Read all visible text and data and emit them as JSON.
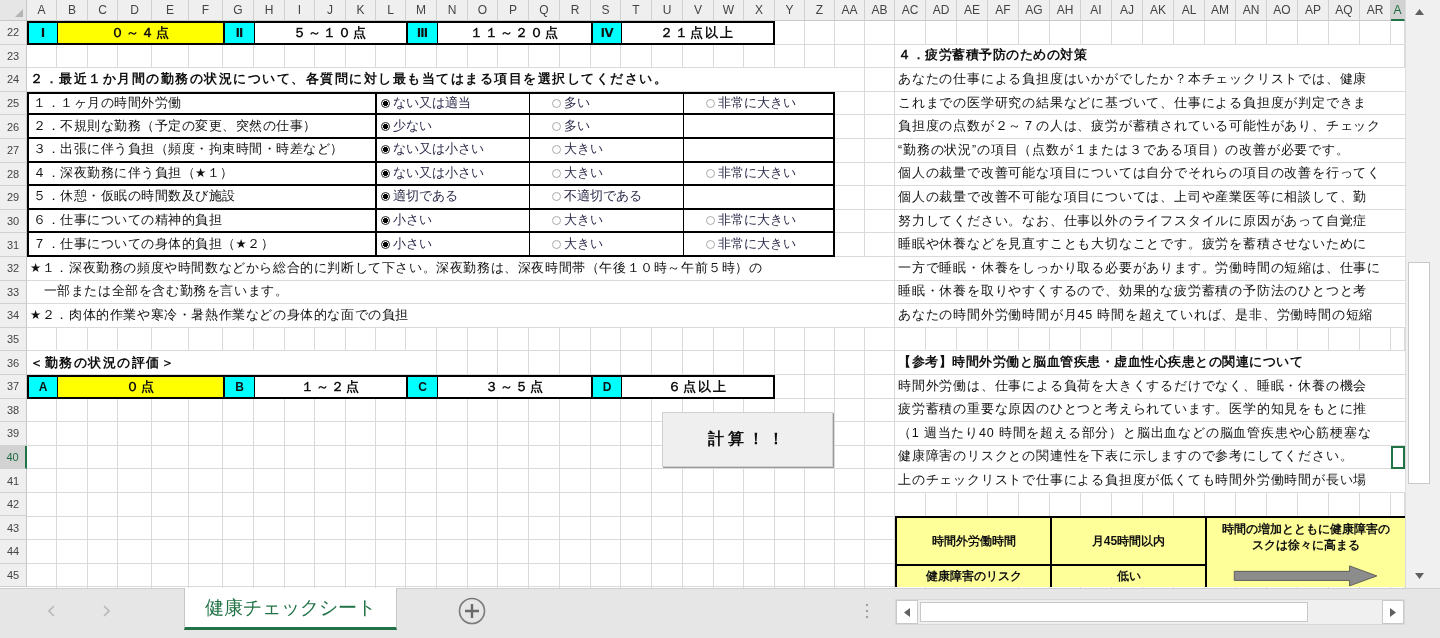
{
  "columns": [
    {
      "label": "A",
      "selected": false
    },
    {
      "label": "B",
      "selected": false
    },
    {
      "label": "C",
      "selected": false
    },
    {
      "label": "D",
      "selected": false
    },
    {
      "label": "E",
      "selected": false
    },
    {
      "label": "F",
      "selected": false
    },
    {
      "label": "G",
      "selected": false
    },
    {
      "label": "H",
      "selected": false
    },
    {
      "label": "I",
      "selected": false
    },
    {
      "label": "J",
      "selected": false
    },
    {
      "label": "K",
      "selected": false
    },
    {
      "label": "L",
      "selected": false
    },
    {
      "label": "M",
      "selected": false
    },
    {
      "label": "N",
      "selected": false
    },
    {
      "label": "O",
      "selected": false
    },
    {
      "label": "P",
      "selected": false
    },
    {
      "label": "Q",
      "selected": false
    },
    {
      "label": "R",
      "selected": false
    },
    {
      "label": "S",
      "selected": false
    },
    {
      "label": "T",
      "selected": false
    },
    {
      "label": "U",
      "selected": false
    },
    {
      "label": "V",
      "selected": false
    },
    {
      "label": "W",
      "selected": false
    },
    {
      "label": "X",
      "selected": false
    },
    {
      "label": "Y",
      "selected": false
    },
    {
      "label": "Z",
      "selected": false
    },
    {
      "label": "AA",
      "selected": false
    },
    {
      "label": "AB",
      "selected": false
    },
    {
      "label": "AC",
      "selected": false
    },
    {
      "label": "AD",
      "selected": false
    },
    {
      "label": "AE",
      "selected": false
    },
    {
      "label": "AF",
      "selected": false
    },
    {
      "label": "AG",
      "selected": false
    },
    {
      "label": "AH",
      "selected": false
    },
    {
      "label": "AI",
      "selected": false
    },
    {
      "label": "AJ",
      "selected": false
    },
    {
      "label": "AK",
      "selected": false
    },
    {
      "label": "AL",
      "selected": false
    },
    {
      "label": "AM",
      "selected": false
    },
    {
      "label": "AN",
      "selected": false
    },
    {
      "label": "AO",
      "selected": false
    },
    {
      "label": "AP",
      "selected": false
    },
    {
      "label": "AQ",
      "selected": false
    },
    {
      "label": "AR",
      "selected": false
    },
    {
      "label": "A",
      "selected": true
    }
  ],
  "rows": [
    {
      "label": "22",
      "selected": false
    },
    {
      "label": "23",
      "selected": false
    },
    {
      "label": "24",
      "selected": false
    },
    {
      "label": "25",
      "selected": false
    },
    {
      "label": "26",
      "selected": false
    },
    {
      "label": "27",
      "selected": false
    },
    {
      "label": "28",
      "selected": false
    },
    {
      "label": "29",
      "selected": false
    },
    {
      "label": "30",
      "selected": false
    },
    {
      "label": "31",
      "selected": false
    },
    {
      "label": "32",
      "selected": false
    },
    {
      "label": "33",
      "selected": false
    },
    {
      "label": "34",
      "selected": false
    },
    {
      "label": "35",
      "selected": false
    },
    {
      "label": "36",
      "selected": false
    },
    {
      "label": "37",
      "selected": false
    },
    {
      "label": "38",
      "selected": false
    },
    {
      "label": "39",
      "selected": false
    },
    {
      "label": "40",
      "selected": true
    },
    {
      "label": "41",
      "selected": false
    },
    {
      "label": "42",
      "selected": false
    },
    {
      "label": "43",
      "selected": false
    },
    {
      "label": "44",
      "selected": false
    },
    {
      "label": "45",
      "selected": false
    }
  ],
  "score_scale": [
    {
      "mark": "Ⅰ",
      "range": "０～４点",
      "highlighted": true
    },
    {
      "mark": "Ⅱ",
      "range": "５～１０点",
      "highlighted": false
    },
    {
      "mark": "Ⅲ",
      "range": "１１～２０点",
      "highlighted": false
    },
    {
      "mark": "Ⅳ",
      "range": "２１点以上",
      "highlighted": false
    }
  ],
  "question_heading": "２．最近１か月間の勤務の状況について、各質問に対し最も当てはまる項目を選択してください。",
  "questions": [
    {
      "label": "１．１ヶ月の時間外労働",
      "options": [
        {
          "text": "ない又は適当",
          "selected": true
        },
        {
          "text": "多い",
          "selected": false
        },
        {
          "text": "非常に大きい",
          "selected": false
        }
      ]
    },
    {
      "label": "２．不規則な勤務（予定の変更、突然の仕事）",
      "options": [
        {
          "text": "少ない",
          "selected": true
        },
        {
          "text": "多い",
          "selected": false
        }
      ]
    },
    {
      "label": "３．出張に伴う負担（頻度・拘束時間・時差など）",
      "options": [
        {
          "text": "ない又は小さい",
          "selected": true
        },
        {
          "text": "大きい",
          "selected": false
        }
      ]
    },
    {
      "label": "４．深夜勤務に伴う負担（★１）",
      "options": [
        {
          "text": "ない又は小さい",
          "selected": true
        },
        {
          "text": "大きい",
          "selected": false
        },
        {
          "text": "非常に大きい",
          "selected": false
        }
      ]
    },
    {
      "label": "５．休憩・仮眠の時間数及び施設",
      "options": [
        {
          "text": "適切である",
          "selected": true
        },
        {
          "text": "不適切である",
          "selected": false
        }
      ]
    },
    {
      "label": "６．仕事についての精神的負担",
      "options": [
        {
          "text": "小さい",
          "selected": true
        },
        {
          "text": "大きい",
          "selected": false
        },
        {
          "text": "非常に大きい",
          "selected": false
        }
      ]
    },
    {
      "label": "７．仕事についての身体的負担（★２）",
      "options": [
        {
          "text": "小さい",
          "selected": true
        },
        {
          "text": "大きい",
          "selected": false
        },
        {
          "text": "非常に大きい",
          "selected": false
        }
      ]
    }
  ],
  "notes": [
    "★１．深夜勤務の頻度や時間数などから総合的に判断して下さい。深夜勤務は、深夜時間帯（午後１０時～午前５時）の",
    "　一部または全部を含む勤務を言います。",
    "★２．肉体的作業や寒冷・暑熱作業などの身体的な面での負担"
  ],
  "evaluation_heading": "＜勤務の状況の評価＞",
  "evaluation_scale": [
    {
      "mark": "A",
      "range": "０点",
      "highlighted": true
    },
    {
      "mark": "B",
      "range": "１～２点",
      "highlighted": false
    },
    {
      "mark": "C",
      "range": "３～５点",
      "highlighted": false
    },
    {
      "mark": "D",
      "range": "６点以上",
      "highlighted": false
    }
  ],
  "calculate_button": "計算！！",
  "advice": {
    "heading": "４．疲労蓄積予防のための対策",
    "lines": [
      "あなたの仕事による負担度はいかがでしたか？本チェックリストでは、健康",
      "これまでの医学研究の結果などに基づいて、仕事による負担度が判定できま",
      "負担度の点数が２～７の人は、疲労が蓄積されている可能性があり、チェック",
      "“勤務の状況”の項目（点数が１または３である項目）の改善が必要です。",
      "個人の裁量で改善可能な項目については自分でそれらの項目の改善を行ってく",
      "個人の裁量で改善不可能な項目については、上司や産業医等に相談して、勤",
      "努力してください。なお、仕事以外のライフスタイルに原因があって自覚症",
      "睡眠や休養などを見直すことも大切なことです。疲労を蓄積させないために",
      "一方で睡眠・休養をしっかり取る必要があります。労働時間の短縮は、仕事に",
      "睡眠・休養を取りやすくするので、効果的な疲労蓄積の予防法のひとつと考",
      "あなたの時間外労働時間が月45 時間を超えていれば、是非、労働時間の短縮"
    ]
  },
  "reference": {
    "heading": "【参考】時間外労働と脳血管疾患・虚血性心疾患との関連について",
    "lines": [
      "時間外労働は、仕事による負荷を大きくするだけでなく、睡眠・休養の機会",
      "疲労蓄積の重要な原因のひとつと考えられています。医学的知見をもとに推",
      "（1 週当たり40 時間を超える部分）と脳出血などの脳血管疾患や心筋梗塞な",
      "健康障害のリスクとの関連性を下表に示しますので参考にしてください。",
      "上のチェックリストで仕事による負担度が低くても時間外労働時間が長い場"
    ]
  },
  "risk_table": {
    "hours_label": "時間外労働時間",
    "threshold": "月45時間以内",
    "trend_lines": [
      "時間の増加とともに健康障害の",
      "スクは徐々に高まる"
    ],
    "risk_label": "健康障害のリスク",
    "risk_level": "低い"
  },
  "sheet_tabs": [
    {
      "label": "健康チェックシート",
      "selected": true
    }
  ]
}
